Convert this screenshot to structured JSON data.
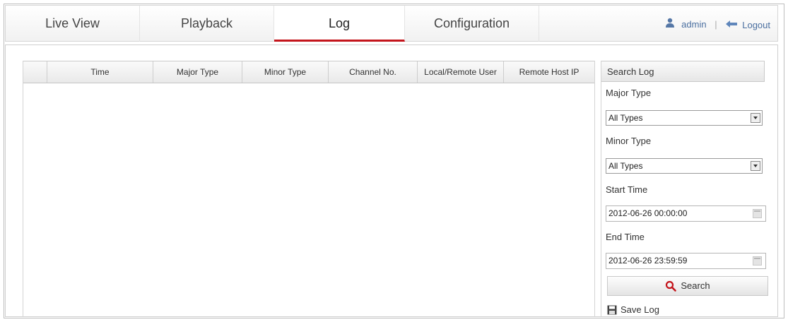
{
  "nav": {
    "tabs": [
      {
        "label": "Live View"
      },
      {
        "label": "Playback"
      },
      {
        "label": "Log"
      },
      {
        "label": "Configuration"
      }
    ],
    "active_tab": "Log",
    "user": "admin",
    "separator": "|",
    "logout_label": "Logout"
  },
  "table": {
    "columns": [
      "",
      "Time",
      "Major Type",
      "Minor Type",
      "Channel No.",
      "Local/Remote User",
      "Remote Host IP"
    ],
    "rows": []
  },
  "search": {
    "title": "Search Log",
    "major_type_label": "Major Type",
    "major_type_value": "All Types",
    "minor_type_label": "Minor Type",
    "minor_type_value": "All Types",
    "start_time_label": "Start Time",
    "start_time_value": "2012-06-26 00:00:00",
    "end_time_label": "End Time",
    "end_time_value": "2012-06-26 23:59:59",
    "search_button": "Search",
    "save_log": "Save Log"
  },
  "colors": {
    "accent": "#c4151c",
    "link": "#4a6fa0"
  }
}
